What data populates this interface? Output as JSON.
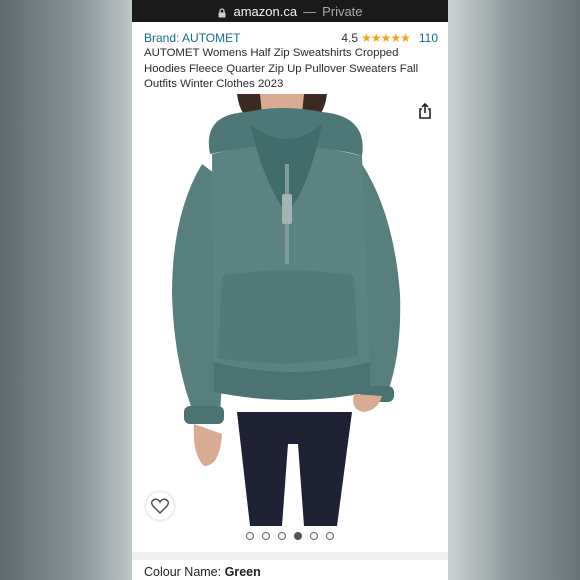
{
  "browser": {
    "domain": "amazon.ca",
    "separator": "—",
    "mode": "Private",
    "lock_icon": "lock-icon"
  },
  "product": {
    "brand_label": "Brand: AUTOMET",
    "rating_value": "4.5",
    "stars": "★★★★★",
    "rating_count": "110",
    "title": "AUTOMET Womens Half Zip Sweatshirts Cropped Hoodies Fleece Quarter Zip Up Pullover Sweaters Fall Outfits Winter Clothes 2023",
    "star_color": "#f2a41a",
    "link_color": "#0f6f8f",
    "hoodie_color": "#547f7e"
  },
  "gallery": {
    "image_count": 6,
    "active_index": 3,
    "share_icon": "share-icon",
    "heart_icon": "heart-icon"
  },
  "variation": {
    "label": "Colour Name:",
    "value": "Green"
  }
}
